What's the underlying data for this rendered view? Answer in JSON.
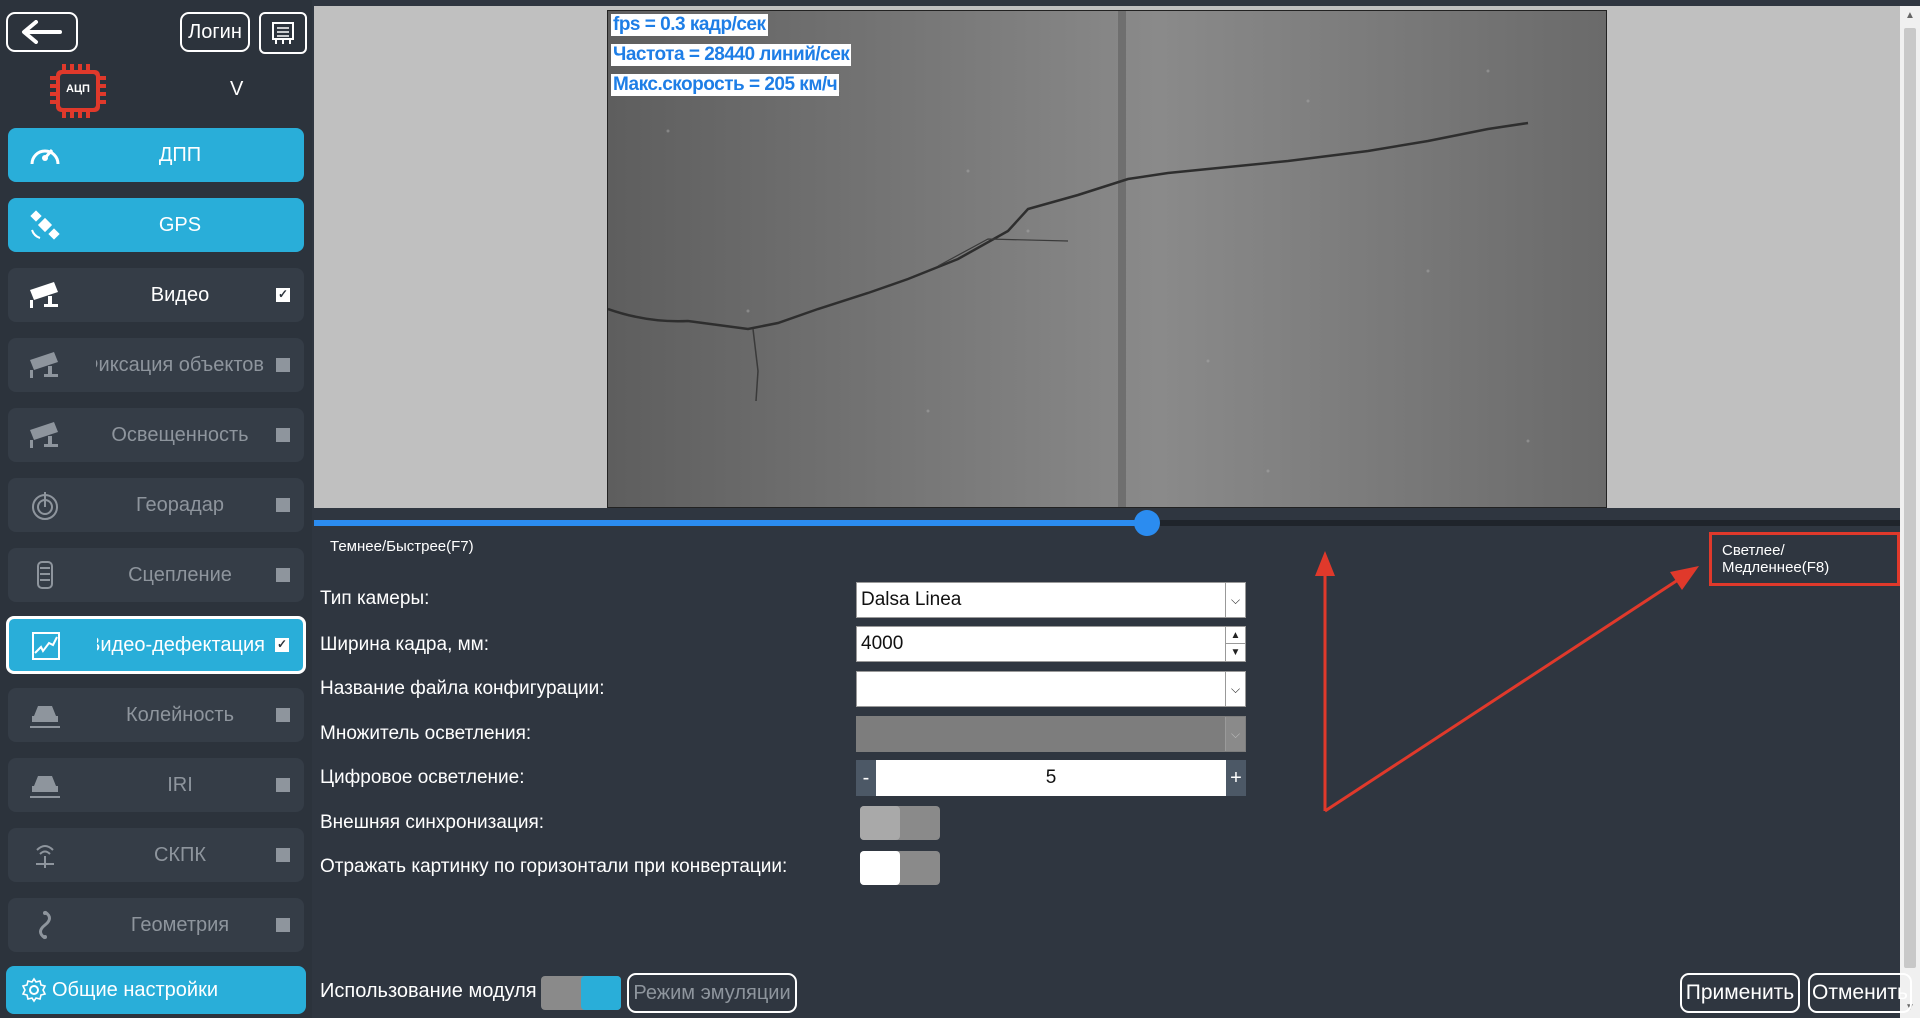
{
  "sidebar": {
    "back_icon": "arrow-left-icon",
    "login_label": "Логин",
    "adc_label": "АЦП",
    "version": "V",
    "items": [
      {
        "label": "ДПП",
        "icon": "speedometer-icon",
        "state": "active"
      },
      {
        "label": "GPS",
        "icon": "satellite-icon",
        "state": "active"
      },
      {
        "label": "Видео",
        "icon": "camera-icon",
        "state": "enabled",
        "checked": true
      },
      {
        "label": "Фиксация объектов",
        "icon": "camera-icon",
        "state": "disabled",
        "checked": false
      },
      {
        "label": "Освещенность",
        "icon": "camera-icon",
        "state": "disabled",
        "checked": false
      },
      {
        "label": "Георадар",
        "icon": "georadar-icon",
        "state": "disabled",
        "checked": false
      },
      {
        "label": "Сцепление",
        "icon": "tire-icon",
        "state": "disabled",
        "checked": false
      },
      {
        "label": "Видео-дефектация",
        "icon": "road-crack-icon",
        "state": "selected",
        "checked": true
      },
      {
        "label": "Колейность",
        "icon": "car-icon",
        "state": "disabled",
        "checked": false
      },
      {
        "label": "IRI",
        "icon": "car-icon",
        "state": "disabled",
        "checked": false
      },
      {
        "label": "СКПК",
        "icon": "antenna-icon",
        "state": "disabled",
        "checked": false
      },
      {
        "label": "Геометрия",
        "icon": "road-curve-icon",
        "state": "disabled",
        "checked": false
      }
    ],
    "settings_label": "Общие настройки"
  },
  "video": {
    "overlay": [
      "fps = 0.3 кадр/сек",
      "Частота = 28440 линий/сек",
      "Макс.скорость = 205 км/ч"
    ]
  },
  "slider": {
    "darker_label": "Темнее/Быстрее(F7)",
    "lighter_label": "Светлее/Медленнее(F8)",
    "value_fraction": 0.525
  },
  "form": {
    "camera_type_label": "Тип камеры:",
    "camera_type_value": "Dalsa Linea",
    "frame_width_label": "Ширина кадра, мм:",
    "frame_width_value": "4000",
    "config_file_label": "Название файла конфигурации:",
    "config_file_value": "",
    "brightness_mult_label": "Множитель осветления:",
    "digital_brightness_label": "Цифровое осветление:",
    "digital_brightness_value": "5",
    "minus": "-",
    "plus": "+",
    "ext_sync_label": "Внешняя синхронизация:",
    "mirror_label": "Отражать картинку по горизонтали при конвертации:"
  },
  "bottom": {
    "module_label": "Использование модуля",
    "emulation_label": "Режим эмуляции",
    "apply_label": "Применить",
    "cancel_label": "Отменить"
  },
  "colors": {
    "accent": "#29aed9",
    "slider": "#2b8cf0",
    "annotation": "#e0392b"
  }
}
